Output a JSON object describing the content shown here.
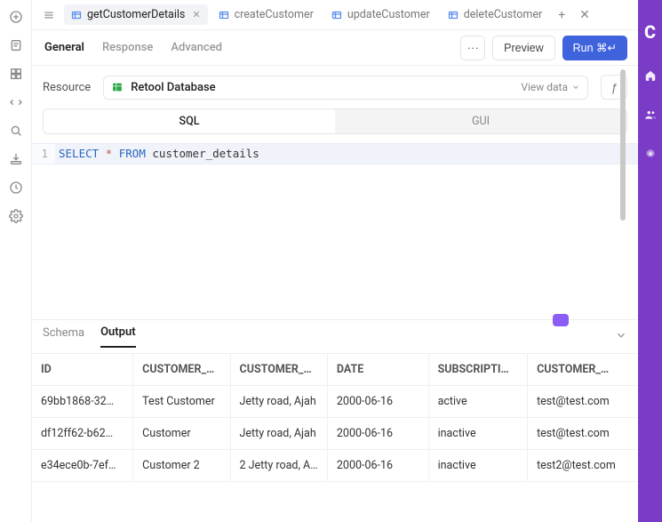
{
  "tabs": [
    {
      "label": "getCustomerDetails",
      "active": true
    },
    {
      "label": "createCustomer",
      "active": false
    },
    {
      "label": "updateCustomer",
      "active": false
    },
    {
      "label": "deleteCustomer",
      "active": false
    }
  ],
  "sub_tabs": {
    "general": "General",
    "response": "Response",
    "advanced": "Advanced"
  },
  "actions": {
    "preview": "Preview",
    "run": "Run ⌘↵"
  },
  "resource": {
    "label": "Resource",
    "name": "Retool Database",
    "view_data": "View data"
  },
  "mode": {
    "sql": "SQL",
    "gui": "GUI"
  },
  "code": {
    "line_num": "1",
    "kw1": "SELECT",
    "star": "*",
    "kw2": "FROM",
    "ident": "customer_details"
  },
  "results": {
    "schema_tab": "Schema",
    "output_tab": "Output",
    "columns": [
      "ID",
      "CUSTOMER_…",
      "CUSTOMER_…",
      "DATE",
      "SUBSCRIPTI…",
      "CUSTOMER_…"
    ],
    "rows": [
      {
        "id": "69bb1868-32…",
        "name": "Test Customer",
        "addr": "Jetty road, Ajah",
        "date": "2000-06-16",
        "sub": "active",
        "email": "test@test.com"
      },
      {
        "id": "df12ff62-b62…",
        "name": "Customer",
        "addr": "Jetty road, Ajah",
        "date": "2000-06-16",
        "sub": "inactive",
        "email": "test@test.com"
      },
      {
        "id": "e34ece0b-7ef…",
        "name": "Customer 2",
        "addr": "2 Jetty road, Aj…",
        "date": "2000-06-16",
        "sub": "inactive",
        "email": "test2@test.com"
      }
    ]
  },
  "brand_initial": "C"
}
